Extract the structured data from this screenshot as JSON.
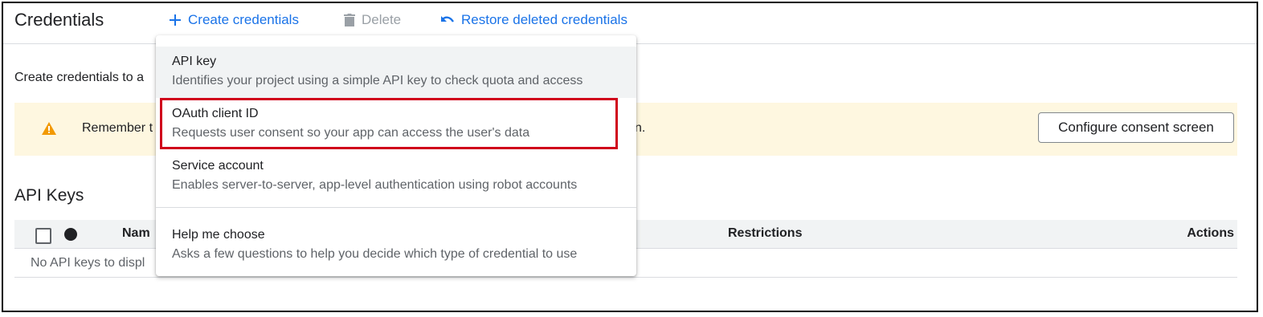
{
  "header": {
    "title": "Credentials",
    "create_label": "Create credentials",
    "delete_label": "Delete",
    "restore_label": "Restore deleted credentials"
  },
  "intro_text": "Create credentials to a",
  "banner": {
    "text": "Remember t",
    "tail": "n.",
    "button_label": "Configure consent screen"
  },
  "api_keys": {
    "title": "API Keys",
    "columns": {
      "name": "Nam",
      "restrictions": "Restrictions",
      "actions": "Actions"
    },
    "empty_message": "No API keys to displ"
  },
  "menu": {
    "items": [
      {
        "label": "API key",
        "description": "Identifies your project using a simple API key to check quota and access"
      },
      {
        "label": "OAuth client ID",
        "description": "Requests user consent so your app can access the user's data"
      },
      {
        "label": "Service account",
        "description": "Enables server-to-server, app-level authentication using robot accounts"
      },
      {
        "label": "Help me choose",
        "description": "Asks a few questions to help you decide which type of credential to use"
      }
    ]
  },
  "colors": {
    "accent": "#1a73e8",
    "warning": "#f29900",
    "banner_bg": "#fef7e0",
    "highlight": "#d0021b"
  },
  "icons": {
    "create": "plus-icon",
    "delete": "trash-icon",
    "restore": "undo-icon",
    "warning": "warning-icon"
  }
}
